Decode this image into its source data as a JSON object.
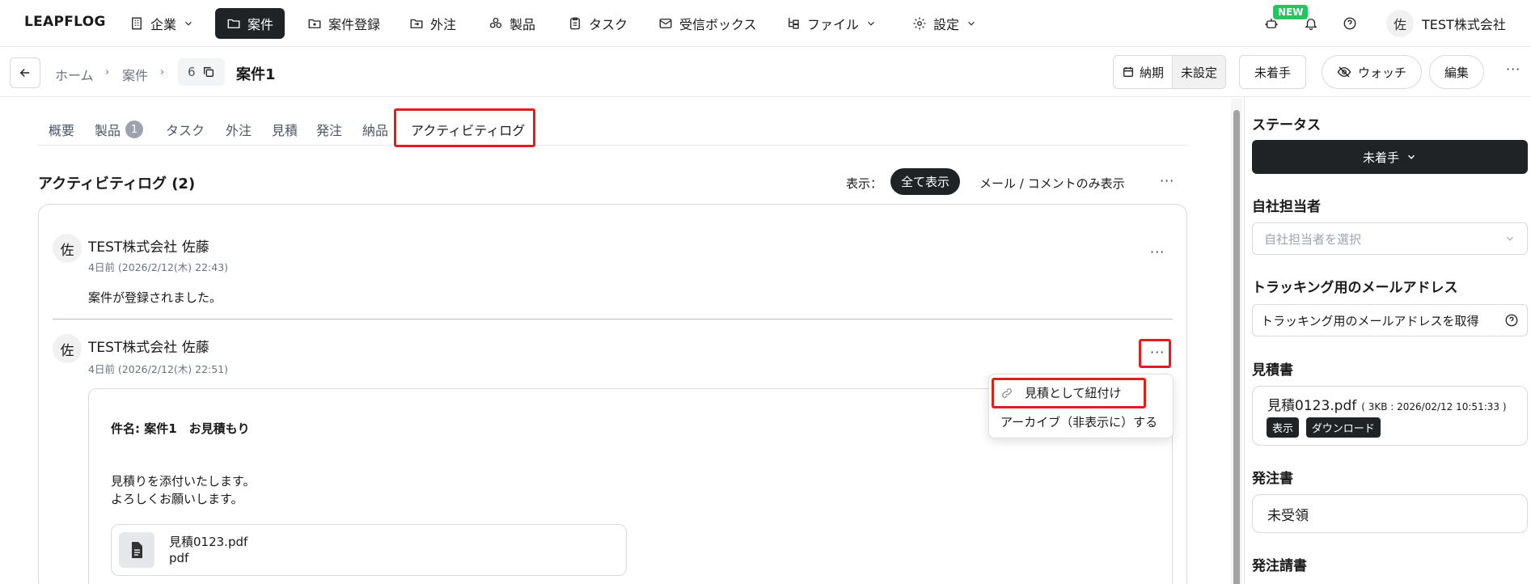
{
  "app": {
    "logo": "LEAPFLOG"
  },
  "nav": {
    "company": "企業",
    "cases": "案件",
    "case_register": "案件登録",
    "outsourcing": "外注",
    "products": "製品",
    "tasks": "タスク",
    "inbox": "受信ボックス",
    "files": "ファイル",
    "settings": "設定",
    "new_badge": "NEW",
    "avatar": "佐",
    "account": "TEST株式会社"
  },
  "breadcrumb": {
    "home": "ホーム",
    "cases": "案件",
    "id": "6",
    "title": "案件1"
  },
  "header_actions": {
    "due_label": "納期",
    "due_value": "未設定",
    "status": "未着手",
    "watch": "ウォッチ",
    "edit": "編集"
  },
  "tabs": [
    {
      "label": "概要"
    },
    {
      "label": "製品",
      "badge": "1"
    },
    {
      "label": "タスク"
    },
    {
      "label": "外注"
    },
    {
      "label": "見積"
    },
    {
      "label": "発注"
    },
    {
      "label": "納品"
    },
    {
      "label": "アクティビティログ"
    }
  ],
  "activity": {
    "title": "アクティビティログ (2)",
    "filter_label": "表示：",
    "filter_all": "全て表示",
    "filter_mail": "メール / コメントのみ表示",
    "entries": [
      {
        "avatar": "佐",
        "author": "TEST株式会社 佐藤",
        "time": "4日前 (2026/2/12(木) 22:43)",
        "text": "案件が登録されました。"
      },
      {
        "avatar": "佐",
        "author": "TEST株式会社 佐藤",
        "time": "4日前 (2026/2/12(木) 22:51)",
        "mail": {
          "subject": "件名: 案件1　お見積もり",
          "body_line1": "見積りを添付いたします。",
          "body_line2": "よろしくお願いします。",
          "attachment_name": "見積0123.pdf",
          "attachment_type": "pdf"
        }
      }
    ],
    "menu": {
      "link_as_quote": "見積として紐付け",
      "archive": "アーカイブ（非表示に）する"
    }
  },
  "sidebar": {
    "status_heading": "ステータス",
    "status_value": "未着手",
    "owner_heading": "自社担当者",
    "owner_placeholder": "自社担当者を選択",
    "tracking_heading": "トラッキング用のメールアドレス",
    "tracking_button": "トラッキング用のメールアドレスを取得",
    "quote_heading": "見積書",
    "quote_file": "見積0123.pdf",
    "quote_meta": "( 3KB : 2026/02/12 10:51:33 )",
    "quote_view": "表示",
    "quote_download": "ダウンロード",
    "order_heading": "発注書",
    "order_value": "未受領",
    "order_confirm_heading": "発注請書"
  },
  "colors": {
    "highlight": "#e11d1d",
    "dark": "#1f2326",
    "new_badge": "#22c55e"
  }
}
